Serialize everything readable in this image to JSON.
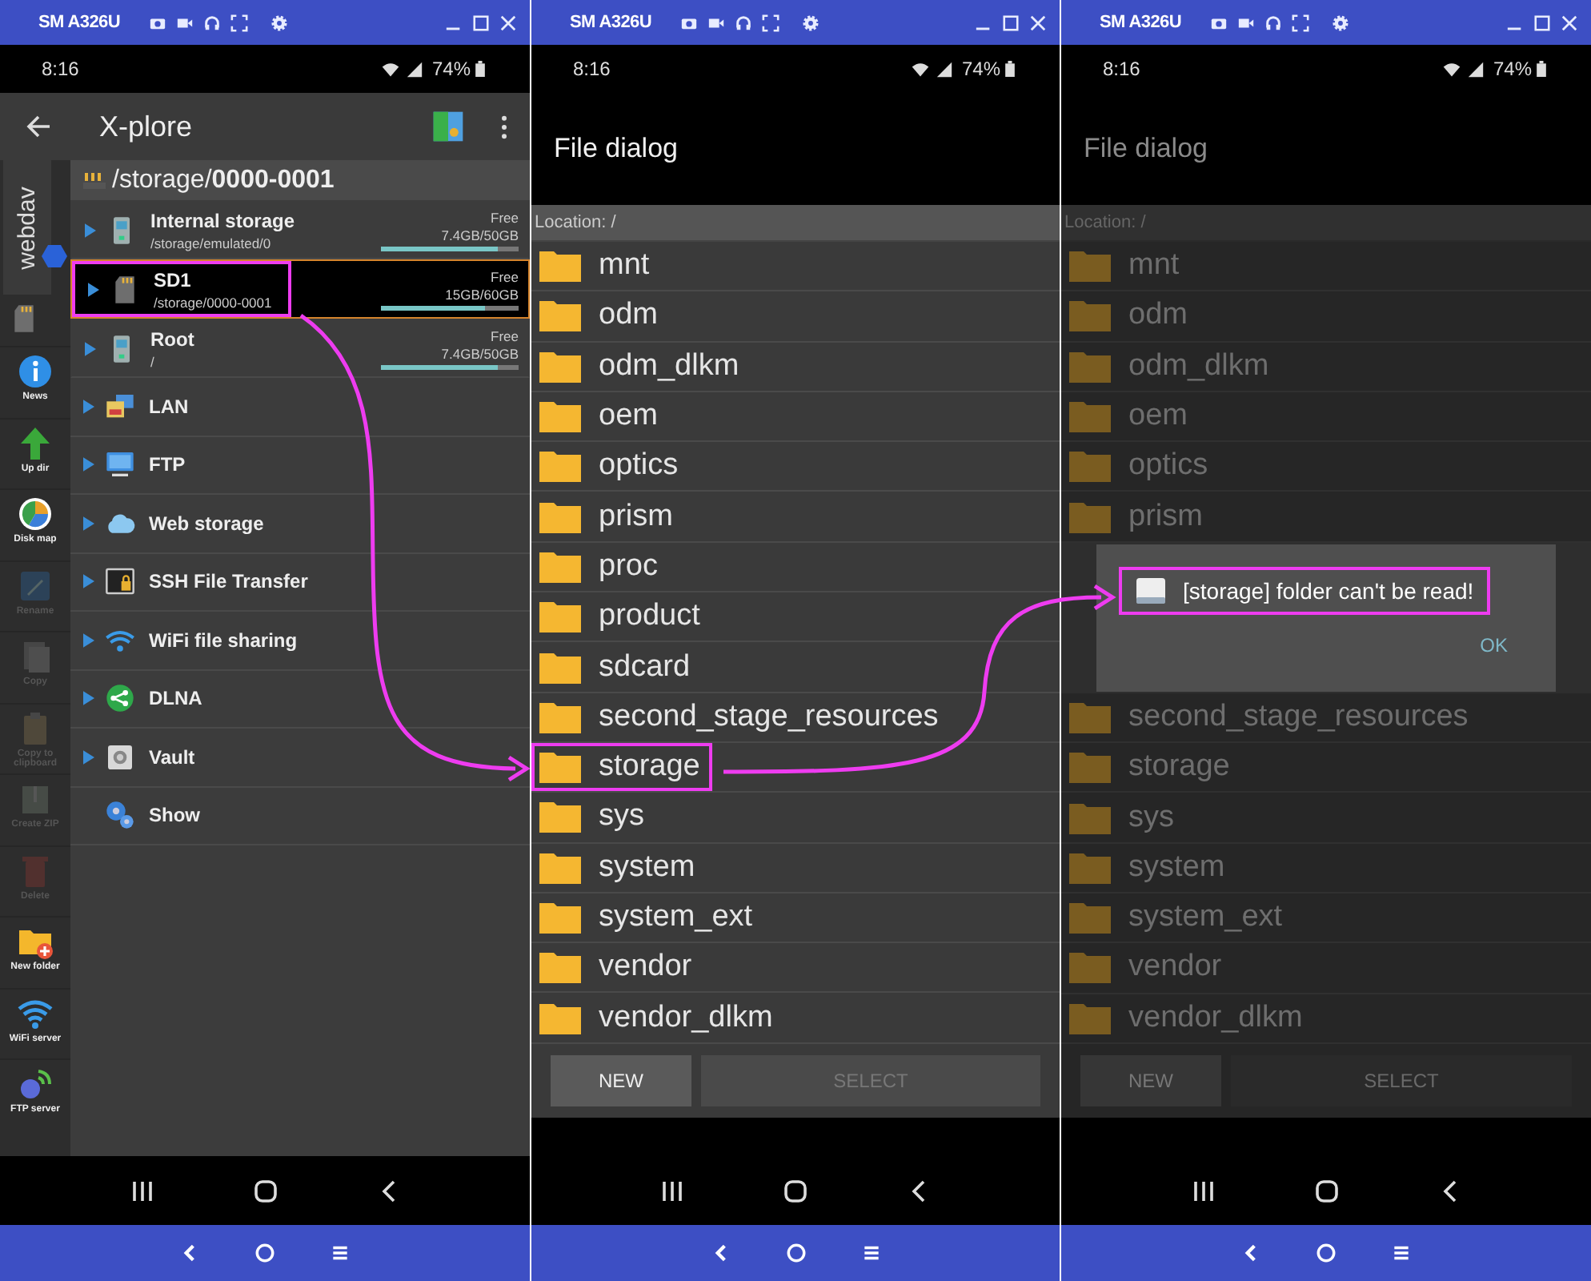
{
  "phones": [
    {
      "kind": "explorer",
      "window": {
        "title": "SM A326U"
      },
      "status": {
        "time": "8:16",
        "battery": "74%"
      },
      "app": {
        "title": "X-plore"
      },
      "path": "/storage/**0000-0001**",
      "side_tab": "webdav",
      "tools": [
        {
          "label": "News",
          "disabled": false
        },
        {
          "label": "Up dir",
          "disabled": false
        },
        {
          "label": "Disk map",
          "disabled": false
        },
        {
          "label": "Rename",
          "disabled": true
        },
        {
          "label": "Copy",
          "disabled": true
        },
        {
          "label": "Copy to clipboard",
          "disabled": true
        },
        {
          "label": "Create ZIP",
          "disabled": true
        },
        {
          "label": "Delete",
          "disabled": true
        },
        {
          "label": "New folder",
          "disabled": false
        },
        {
          "label": "WiFi server",
          "disabled": false
        },
        {
          "label": "FTP server",
          "disabled": false
        }
      ],
      "locations": [
        {
          "kind": "storage",
          "name": "Internal storage",
          "path": "/storage/emulated/0",
          "free_label": "Free",
          "space": "7.4GB/50GB",
          "level": 0.85,
          "selected": false,
          "highlighted": false
        },
        {
          "kind": "storage",
          "name": "SD1",
          "path": "/storage/0000-0001",
          "free_label": "Free",
          "space": "15GB/60GB",
          "level": 0.75,
          "selected": true,
          "highlighted": true
        },
        {
          "kind": "storage",
          "name": "Root",
          "path": "/",
          "free_label": "Free",
          "space": "7.4GB/50GB",
          "level": 0.85,
          "selected": false,
          "highlighted": false
        },
        {
          "kind": "entry",
          "name": "LAN"
        },
        {
          "kind": "entry",
          "name": "FTP"
        },
        {
          "kind": "entry",
          "name": "Web storage"
        },
        {
          "kind": "entry",
          "name": "SSH File Transfer"
        },
        {
          "kind": "entry",
          "name": "WiFi file sharing"
        },
        {
          "kind": "entry",
          "name": "DLNA"
        },
        {
          "kind": "entry",
          "name": "Vault"
        },
        {
          "kind": "setting",
          "name": "Show"
        }
      ]
    },
    {
      "kind": "file_dialog",
      "window": {
        "title": "SM A326U"
      },
      "status": {
        "time": "8:16",
        "battery": "74%"
      },
      "title": "File dialog",
      "location": "Location: /",
      "dimmed": false,
      "folders": [
        {
          "name": "mnt",
          "highlighted": false
        },
        {
          "name": "odm",
          "highlighted": false
        },
        {
          "name": "odm_dlkm",
          "highlighted": false
        },
        {
          "name": "oem",
          "highlighted": false
        },
        {
          "name": "optics",
          "highlighted": false
        },
        {
          "name": "prism",
          "highlighted": false
        },
        {
          "name": "proc",
          "highlighted": false
        },
        {
          "name": "product",
          "highlighted": false
        },
        {
          "name": "sdcard",
          "highlighted": false
        },
        {
          "name": "second_stage_resources",
          "highlighted": false
        },
        {
          "name": "storage",
          "highlighted": true
        },
        {
          "name": "sys",
          "highlighted": false
        },
        {
          "name": "system",
          "highlighted": false
        },
        {
          "name": "system_ext",
          "highlighted": false
        },
        {
          "name": "vendor",
          "highlighted": false
        },
        {
          "name": "vendor_dlkm",
          "highlighted": false
        }
      ],
      "buttons": [
        {
          "label": "NEW",
          "disabled": false
        },
        {
          "label": "SELECT",
          "disabled": true
        }
      ]
    },
    {
      "kind": "file_dialog",
      "window": {
        "title": "SM A326U"
      },
      "status": {
        "time": "8:16",
        "battery": "74%"
      },
      "title": "File dialog",
      "location": "Location: /",
      "dimmed": true,
      "folders": [
        {
          "name": "mnt",
          "highlighted": false
        },
        {
          "name": "odm",
          "highlighted": false
        },
        {
          "name": "odm_dlkm",
          "highlighted": false
        },
        {
          "name": "oem",
          "highlighted": false
        },
        {
          "name": "optics",
          "highlighted": false
        },
        {
          "name": "prism",
          "highlighted": false
        }
      ],
      "dialog": {
        "message": "[storage] folder can't be read!",
        "highlighted": true,
        "button": "OK"
      },
      "folders_below": [
        {
          "name": "second_stage_resources",
          "highlighted": false
        },
        {
          "name": "storage",
          "highlighted": false
        },
        {
          "name": "sys",
          "highlighted": false
        },
        {
          "name": "system",
          "highlighted": false
        },
        {
          "name": "system_ext",
          "highlighted": false
        },
        {
          "name": "vendor",
          "highlighted": false
        },
        {
          "name": "vendor_dlkm",
          "highlighted": false
        }
      ],
      "buttons": [
        {
          "label": "NEW",
          "disabled": false
        },
        {
          "label": "SELECT",
          "disabled": true
        }
      ]
    }
  ]
}
